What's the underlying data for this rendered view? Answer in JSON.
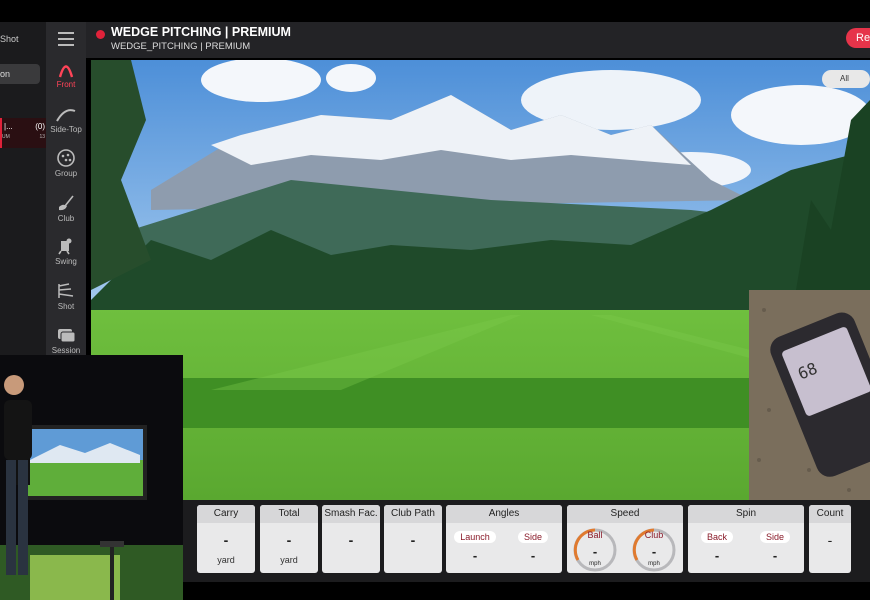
{
  "left_panel": {
    "title": "Shot",
    "button_label": "on",
    "row": {
      "name": "|...",
      "count": "(0)",
      "sub": "UM",
      "sub_count": "13"
    }
  },
  "nav": {
    "items": [
      {
        "label": "Front",
        "icon": "front-arc-icon",
        "active": true
      },
      {
        "label": "Side-Top",
        "icon": "side-top-icon",
        "active": false
      },
      {
        "label": "Group",
        "icon": "group-icon",
        "active": false
      },
      {
        "label": "Club",
        "icon": "club-icon",
        "active": false
      },
      {
        "label": "Swing",
        "icon": "swing-icon",
        "active": false
      },
      {
        "label": "Shot",
        "icon": "shot-icon",
        "active": false
      },
      {
        "label": "Session",
        "icon": "session-icon",
        "active": false
      }
    ],
    "menu_icon": "hamburger-icon"
  },
  "header": {
    "title": "WEDGE PITCHING | PREMIUM",
    "subtitle": "WEDGE_PITCHING | PREMIUM",
    "reset_label": "Re",
    "accent": "#e6344a"
  },
  "filter": {
    "label": "All"
  },
  "stats": {
    "carry": {
      "label": "Carry",
      "value": "-",
      "unit": "yard"
    },
    "total": {
      "label": "Total",
      "value": "-",
      "unit": "yard"
    },
    "smash": {
      "label": "Smash Fac.",
      "value": "-"
    },
    "club_path": {
      "label": "Club Path",
      "value": "-"
    },
    "angles": {
      "label": "Angles",
      "launch_label": "Launch",
      "launch_value": "-",
      "side_label": "Side",
      "side_value": "-"
    },
    "speed": {
      "label": "Speed",
      "ball_label": "Ball",
      "ball_value": "-",
      "ball_unit": "mph",
      "club_label": "Club",
      "club_value": "-",
      "club_unit": "mph"
    },
    "spin": {
      "label": "Spin",
      "back_label": "Back",
      "back_value": "-",
      "side_label": "Side",
      "side_value": "-"
    },
    "count": {
      "label": "Count",
      "value": "-"
    }
  }
}
